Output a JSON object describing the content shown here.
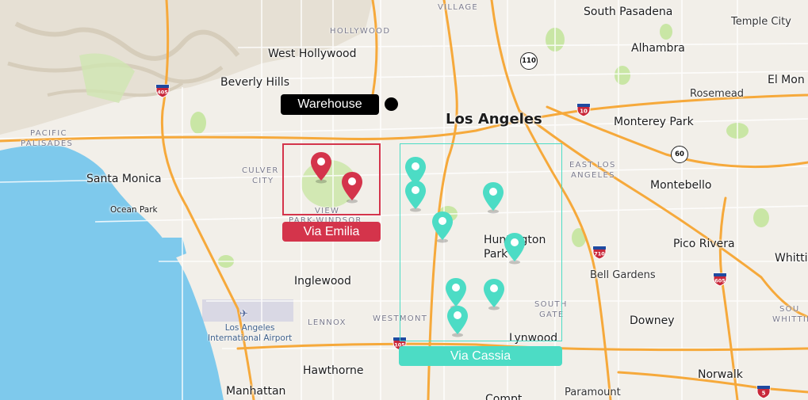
{
  "colors": {
    "water": "#7ec9ec",
    "land": "#f2efe9",
    "park": "#c9e6a5",
    "highway": "#f6a93b",
    "emilia": "#d4344b",
    "cassia": "#4cdcc5",
    "warehouse": "#000000"
  },
  "cities": {
    "los_angeles": "Los Angeles",
    "south_pasadena": "South Pasadena",
    "temple_city": "Temple City",
    "alhambra": "Alhambra",
    "west_hollywood": "West Hollywood",
    "beverly_hills": "Beverly Hills",
    "el_monte": "El Mon",
    "rosemead": "Rosemead",
    "monterey_park": "Monterey Park",
    "montebello": "Montebello",
    "santa_monica": "Santa Monica",
    "ocean_park": "Ocean Park",
    "huntington_park": "Huntington Park",
    "pico_rivera": "Pico Rivera",
    "whittier": "Whitti",
    "bell_gardens": "Bell Gardens",
    "inglewood": "Inglewood",
    "downey": "Downey",
    "lynwood": "Lynwood",
    "hawthorne": "Hawthorne",
    "norwalk": "Norwalk",
    "manhattan": "Manhattan",
    "paramount": "Paramount",
    "compton_partial": "Compt"
  },
  "districts": {
    "village": "VILLAGE",
    "hollywood": "HOLLYWOOD",
    "pacific_palisades_1": "PACIFIC",
    "pacific_palisades_2": "PALISADES",
    "culver_city_1": "CULVER",
    "culver_city_2": "CITY",
    "east_los_angeles_1": "EAST LOS",
    "east_los_angeles_2": "ANGELES",
    "view_park_1": "VIEW",
    "view_park_2": "PARK-WINDSOR",
    "lennox": "LENNOX",
    "westmont": "WESTMONT",
    "south_gate_1": "SOUTH",
    "south_gate_2": "GATE",
    "south_whittier_1": "SOU",
    "south_whittier_2": "WHITTIE"
  },
  "poi": {
    "lax_1": "Los Angeles",
    "lax_2": "International Airport"
  },
  "shields": {
    "i405_a": "405",
    "i405_b": "405",
    "i10": "10",
    "i710": "710",
    "i605": "605",
    "i105": "105",
    "i5": "5",
    "ca110": "110",
    "ca60": "60"
  },
  "overlays": {
    "warehouse_label": "Warehouse",
    "via_emilia_label": "Via Emilia",
    "via_cassia_label": "Via Cassia"
  },
  "markers": {
    "emilia_count": 2,
    "cassia_count": 8
  }
}
